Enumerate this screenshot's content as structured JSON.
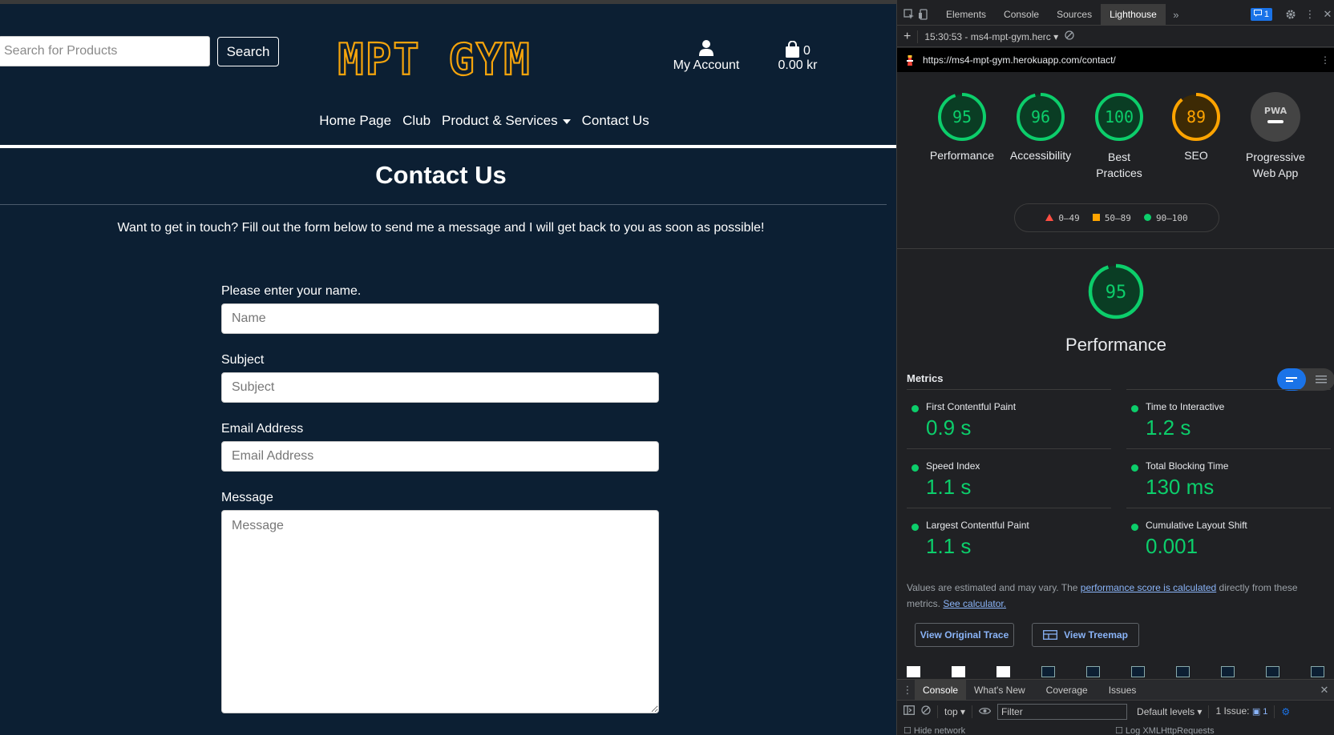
{
  "site": {
    "search": {
      "placeholder": "Search for Products",
      "button": "Search"
    },
    "logo_text": "MPT GYM",
    "account_label": "My Account",
    "cart": {
      "count": "0",
      "total": "0.00 kr"
    },
    "nav": [
      "Home Page",
      "Club",
      "Product & Services",
      "Contact Us"
    ],
    "title": "Contact Us",
    "intro": "Want to get in touch? Fill out the form below to send me a message and I will get back to you as soon as possible!",
    "form": {
      "name_label": "Please enter your name.",
      "name_placeholder": "Name",
      "subject_label": "Subject",
      "subject_placeholder": "Subject",
      "email_label": "Email Address",
      "email_placeholder": "Email Address",
      "message_label": "Message",
      "message_placeholder": "Message"
    },
    "colors": {
      "background": "#0c1f33",
      "logo": "#f5a40c",
      "text": "#ffffff"
    }
  },
  "devtools": {
    "tabs": [
      "Elements",
      "Console",
      "Sources",
      "Lighthouse"
    ],
    "active_tab": "Lighthouse",
    "issues_badge": "1",
    "report_select": "15:30:53 - ms4-mpt-gym.herc",
    "url": "https://ms4-mpt-gym.herokuapp.com/contact/",
    "scores": [
      {
        "value": 95,
        "label": "Performance",
        "color": "#0cce6b"
      },
      {
        "value": 96,
        "label": "Accessibility",
        "color": "#0cce6b"
      },
      {
        "value": 100,
        "label": "Best Practices",
        "color": "#0cce6b"
      },
      {
        "value": 89,
        "label": "SEO",
        "color": "#ffa400"
      }
    ],
    "pwa_label": "Progressive Web App",
    "pwa_badge": "PWA",
    "legend": [
      "0–49",
      "50–89",
      "90–100"
    ],
    "main_score": {
      "value": 95,
      "label": "Performance"
    },
    "metrics_heading": "Metrics",
    "metrics": [
      {
        "label": "First Contentful Paint",
        "value": "0.9 s"
      },
      {
        "label": "Time to Interactive",
        "value": "1.2 s"
      },
      {
        "label": "Speed Index",
        "value": "1.1 s"
      },
      {
        "label": "Total Blocking Time",
        "value": "130 ms"
      },
      {
        "label": "Largest Contentful Paint",
        "value": "1.1 s"
      },
      {
        "label": "Cumulative Layout Shift",
        "value": "0.001"
      }
    ],
    "note": {
      "before": "Values are estimated and may vary. The ",
      "link1": "performance score is calculated",
      "middle": " directly from these metrics. ",
      "link2": "See calculator."
    },
    "buttons": {
      "trace": "View Original Trace",
      "treemap": "View Treemap"
    },
    "drawer_tabs": [
      "Console",
      "What's New",
      "Coverage",
      "Issues"
    ],
    "console": {
      "context": "top",
      "filter_placeholder": "Filter",
      "levels": "Default levels",
      "issues": "1 Issue:",
      "issues_count": "1"
    },
    "partial": {
      "left": "Hide network",
      "right": "Log XMLHttpRequests"
    }
  }
}
